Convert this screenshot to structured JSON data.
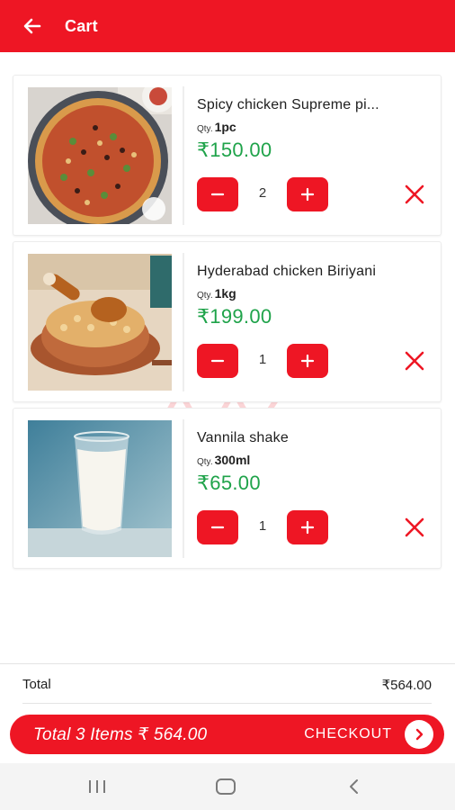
{
  "header": {
    "title": "Cart",
    "back_icon": "arrow-left-icon",
    "background": "#ee1624"
  },
  "cart_items": [
    {
      "name": "Spicy chicken Supreme pi...",
      "qty_label": "Qty.",
      "qty_value": "1pc",
      "price": "₹150.00",
      "count": "2",
      "image": "pizza-image"
    },
    {
      "name": "Hyderabad chicken Biriyani",
      "qty_label": "Qty.",
      "qty_value": "1kg",
      "price": "₹199.00",
      "count": "1",
      "image": "biriyani-image"
    },
    {
      "name": "Vannila shake",
      "qty_label": "Qty.",
      "qty_value": "300ml",
      "price": "₹65.00",
      "count": "1",
      "image": "milkshake-image"
    }
  ],
  "summary": {
    "total_label": "Total",
    "total_value": "₹564.00"
  },
  "checkout": {
    "summary_text": "Total 3 Items ₹ 564.00",
    "button_label": "CHECKOUT",
    "arrow_icon": "chevron-right-icon"
  },
  "system_nav": {
    "recents_icon": "recents-icon",
    "home_icon": "home-icon",
    "back_icon": "back-chevron-icon"
  },
  "colors": {
    "accent": "#ee1624",
    "price_green": "#1fa34a"
  }
}
